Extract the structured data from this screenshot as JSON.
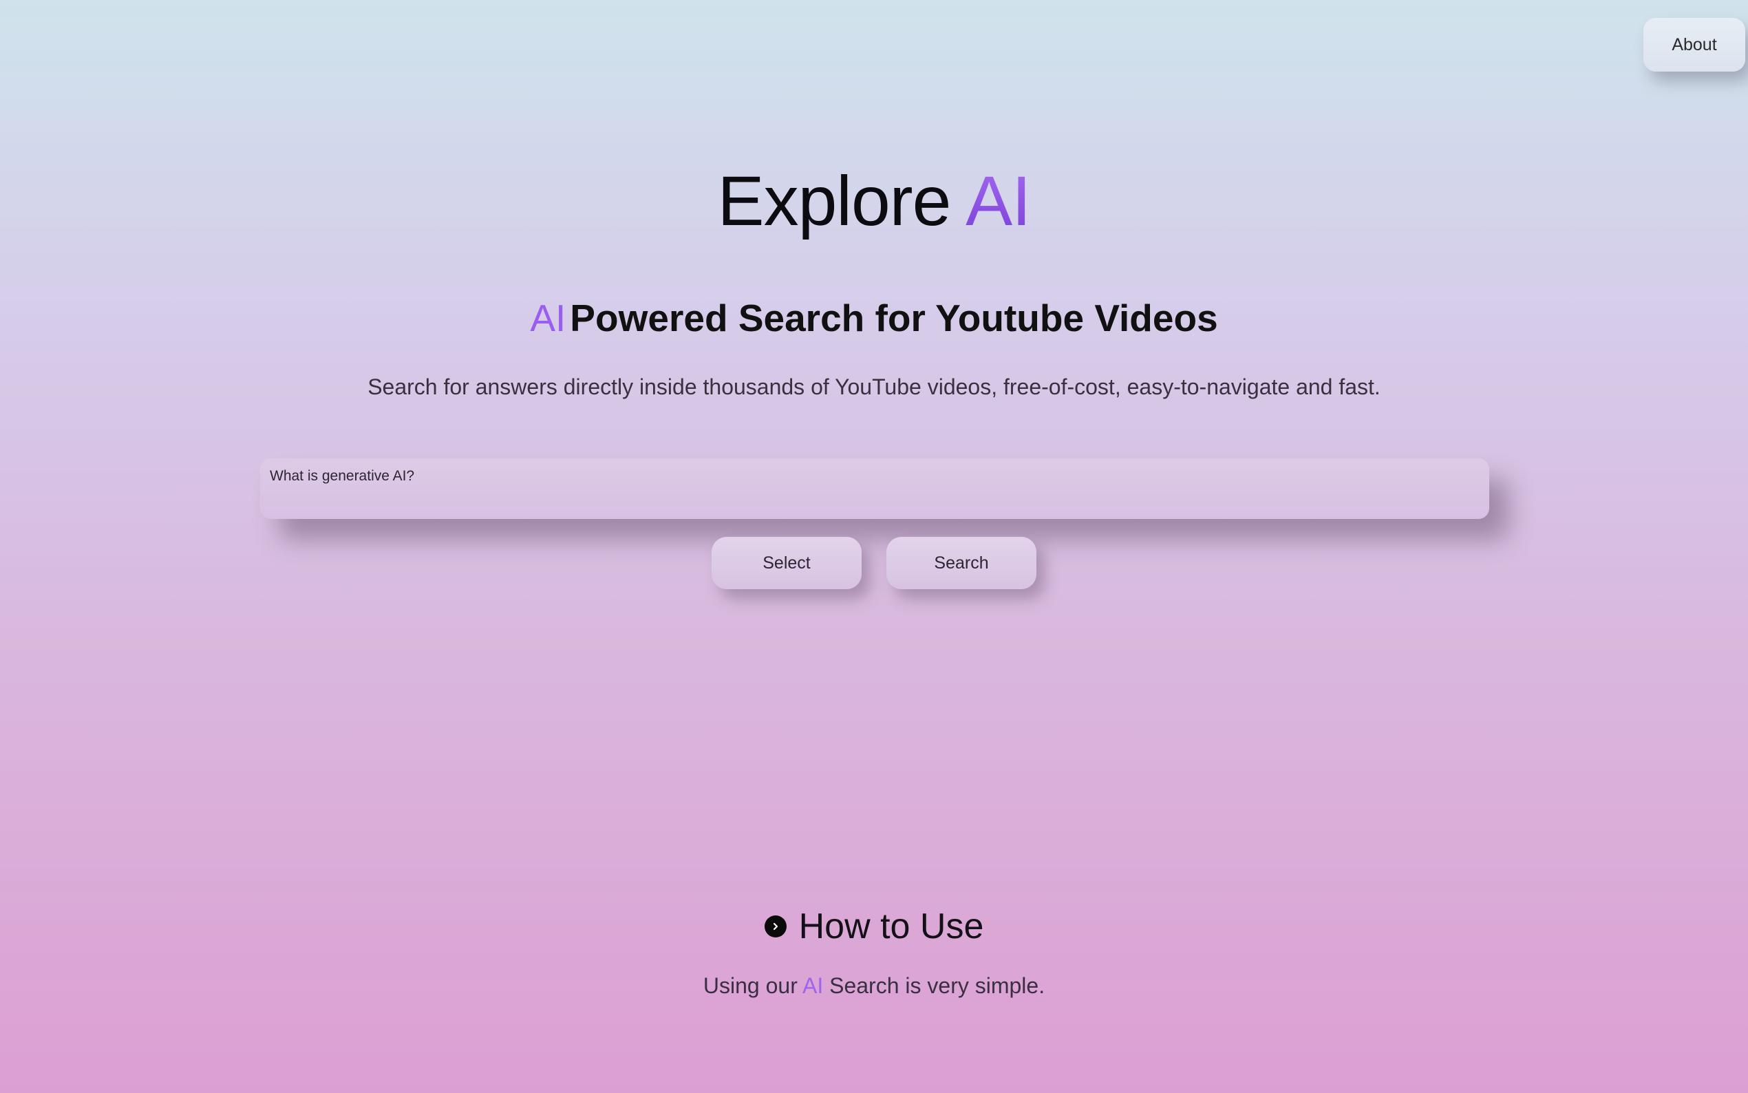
{
  "nav": {
    "about_label": "About"
  },
  "hero": {
    "title_prefix": "Explore",
    "title_accent": "AI",
    "subtitle_accent": "AI",
    "subtitle_rest": "Powered Search for Youtube Videos",
    "description": "Search for answers directly inside thousands of YouTube videos, free-of-cost, easy-to-navigate and fast."
  },
  "search": {
    "value": "What is generative AI?",
    "select_label": "Select",
    "search_label": "Search"
  },
  "howto": {
    "title": "How to Use",
    "desc_prefix": "Using our",
    "desc_accent": "AI",
    "desc_suffix": "Search is very simple."
  },
  "colors": {
    "accent": "#9b5cf0",
    "gradient_top": "#cfe3ec",
    "gradient_bottom": "#dc9fd3"
  },
  "icons": {
    "howto": "chevron-right-circle-icon"
  }
}
